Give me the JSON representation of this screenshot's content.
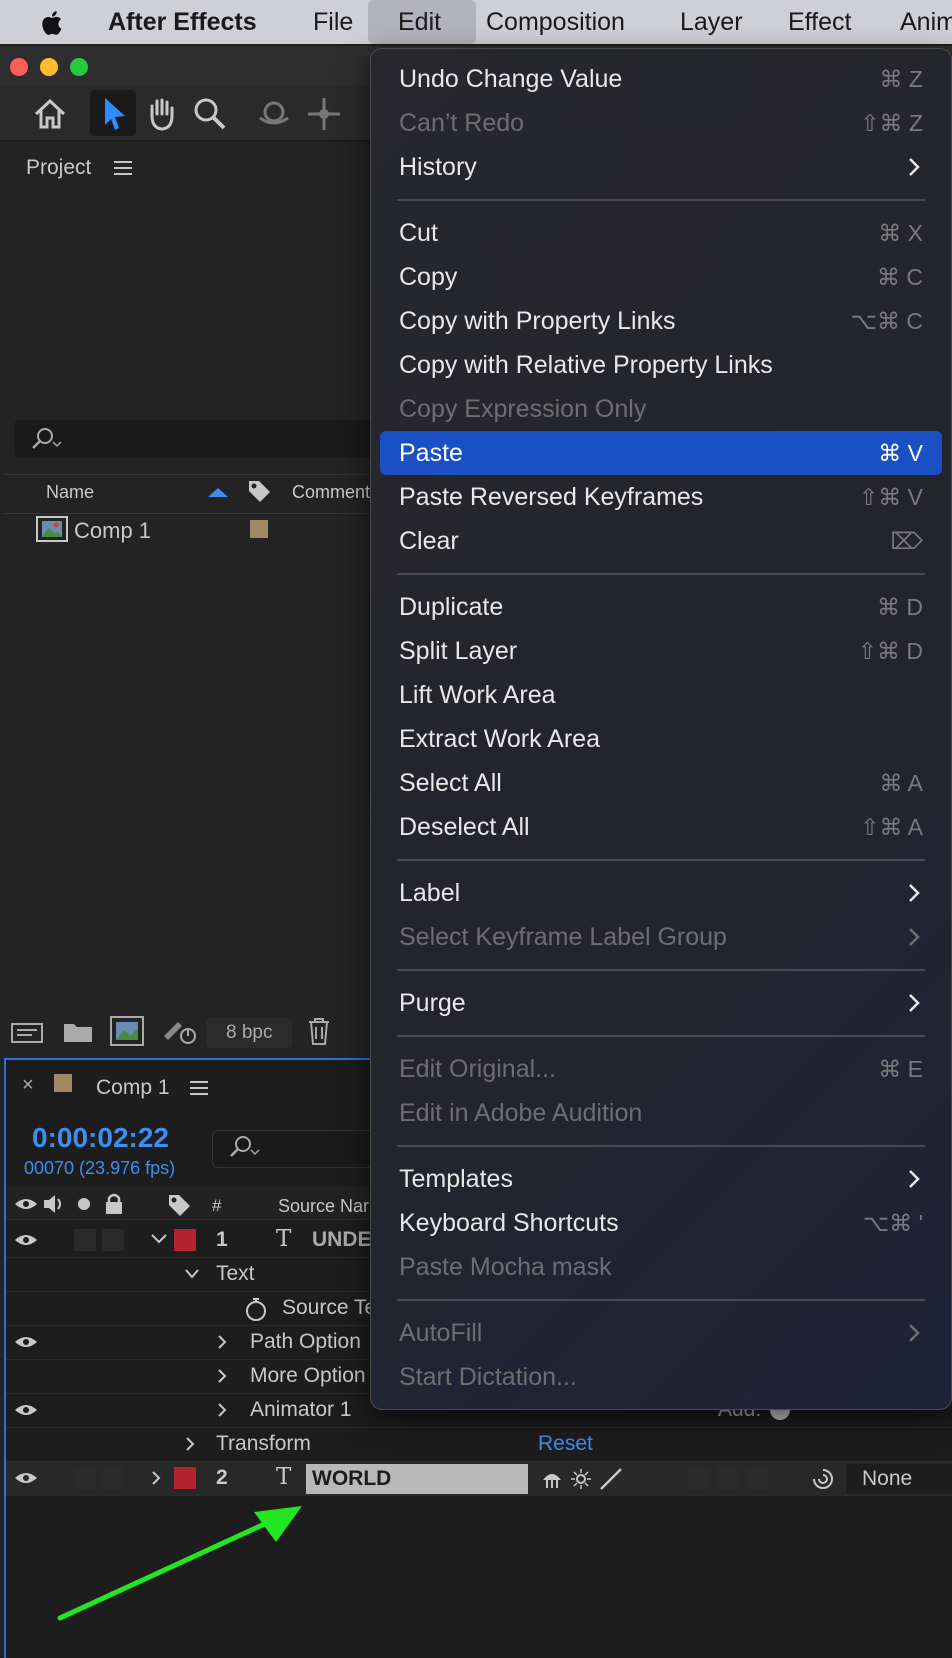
{
  "menubar": {
    "app": "After Effects",
    "items": [
      "File",
      "Edit",
      "Composition",
      "Layer",
      "Effect",
      "Anim"
    ]
  },
  "project_panel": {
    "title": "Project",
    "columns": {
      "name": "Name",
      "comment": "Comment"
    },
    "items": [
      {
        "name": "Comp 1",
        "label_color": "#a08a66"
      }
    ],
    "bpc": "8 bpc"
  },
  "timeline": {
    "comp_tab": "Comp 1",
    "timecode": "0:00:02:22",
    "frame_info": "00070 (23.976 fps)",
    "col_num": "#",
    "col_source": "Source Nar",
    "layers": [
      {
        "num": "1",
        "name": "UNDE",
        "type_icon": "T"
      },
      {
        "num": "2",
        "name": "WORLD",
        "type_icon": "T"
      }
    ],
    "props": {
      "text": "Text",
      "source_text": "Source Te",
      "path_options": "Path Option",
      "more_options": "More Option",
      "animator": "Animator 1",
      "transform": "Transform",
      "reset": "Reset",
      "add": "Add:",
      "none": "None"
    }
  },
  "edit_menu": {
    "groups": [
      [
        {
          "label": "Undo Change Value",
          "shortcut": "⌘ Z",
          "enabled": true
        },
        {
          "label": "Can’t Redo",
          "shortcut": "⇧⌘ Z",
          "enabled": false
        },
        {
          "label": "History",
          "submenu": true,
          "enabled": true
        }
      ],
      [
        {
          "label": "Cut",
          "shortcut": "⌘ X",
          "enabled": true
        },
        {
          "label": "Copy",
          "shortcut": "⌘ C",
          "enabled": true
        },
        {
          "label": "Copy with Property Links",
          "shortcut": "⌥⌘ C",
          "enabled": true
        },
        {
          "label": "Copy with Relative Property Links",
          "shortcut": "",
          "enabled": true
        },
        {
          "label": "Copy Expression Only",
          "shortcut": "",
          "enabled": false
        },
        {
          "label": "Paste",
          "shortcut": "⌘ V",
          "enabled": true,
          "highlighted": true
        },
        {
          "label": "Paste Reversed Keyframes",
          "shortcut": "⇧⌘ V",
          "enabled": true
        },
        {
          "label": "Clear",
          "shortcut": "⌦",
          "enabled": true
        }
      ],
      [
        {
          "label": "Duplicate",
          "shortcut": "⌘ D",
          "enabled": true
        },
        {
          "label": "Split Layer",
          "shortcut": "⇧⌘ D",
          "enabled": true
        },
        {
          "label": "Lift Work Area",
          "shortcut": "",
          "enabled": true
        },
        {
          "label": "Extract Work Area",
          "shortcut": "",
          "enabled": true
        },
        {
          "label": "Select All",
          "shortcut": "⌘ A",
          "enabled": true
        },
        {
          "label": "Deselect All",
          "shortcut": "⇧⌘ A",
          "enabled": true
        }
      ],
      [
        {
          "label": "Label",
          "submenu": true,
          "enabled": true
        },
        {
          "label": "Select Keyframe Label Group",
          "submenu": true,
          "enabled": false
        }
      ],
      [
        {
          "label": "Purge",
          "submenu": true,
          "enabled": true
        }
      ],
      [
        {
          "label": "Edit Original...",
          "shortcut": "⌘ E",
          "enabled": false
        },
        {
          "label": "Edit in Adobe Audition",
          "shortcut": "",
          "enabled": false
        }
      ],
      [
        {
          "label": "Templates",
          "submenu": true,
          "enabled": true
        },
        {
          "label": "Keyboard Shortcuts",
          "shortcut": "⌥⌘ '",
          "enabled": true
        },
        {
          "label": "Paste Mocha mask",
          "shortcut": "",
          "enabled": false
        }
      ],
      [
        {
          "label": "AutoFill",
          "submenu": true,
          "enabled": false
        },
        {
          "label": "Start Dictation...",
          "shortcut": "",
          "enabled": false
        }
      ]
    ]
  },
  "colors": {
    "highlight": "#1b4fc4",
    "timecode": "#3d8ef0",
    "annotation_arrow": "#22e622"
  }
}
